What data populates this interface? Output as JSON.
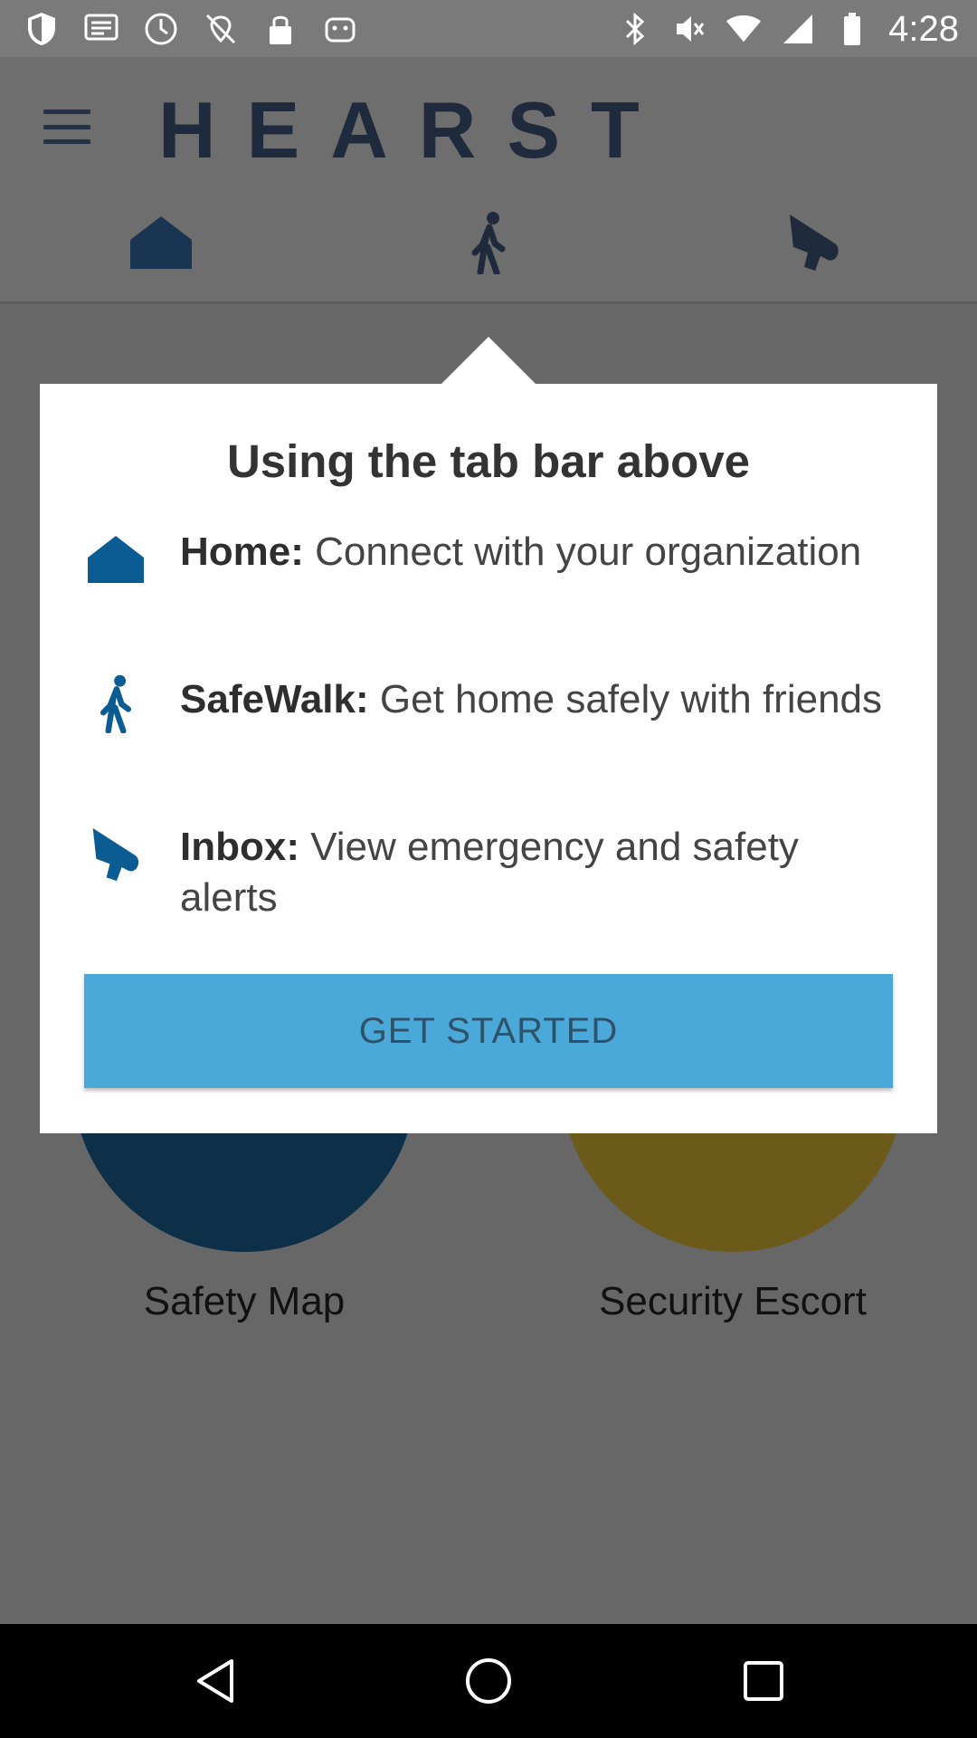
{
  "status_bar": {
    "time": "4:28",
    "left_icons": [
      "shield-icon",
      "message-icon",
      "do-not-disturb-icon",
      "no-location-icon",
      "lock-icon",
      "app-icon"
    ],
    "right_icons": [
      "bluetooth-icon",
      "mute-icon",
      "wifi-icon",
      "signal-icon",
      "battery-icon"
    ]
  },
  "header": {
    "logo_text": "HEARST",
    "tabs": [
      "home-icon",
      "walker-icon",
      "megaphone-icon"
    ]
  },
  "background": {
    "tiles": [
      {
        "label": "Safety Map",
        "color": "#0d2f47"
      },
      {
        "label": "Security Escort",
        "color": "#6b5a1a"
      }
    ]
  },
  "dialog": {
    "title": "Using the tab bar above",
    "items": [
      {
        "icon": "home-icon",
        "label": "Home:",
        "text": " Connect with your organization"
      },
      {
        "icon": "walker-icon",
        "label": "SafeWalk:",
        "text": " Get home safely with friends"
      },
      {
        "icon": "megaphone-icon",
        "label": "Inbox:",
        "text": " View emergency and safety alerts"
      }
    ],
    "button_label": "GET STARTED"
  },
  "colors": {
    "accent": "#4aa9d8",
    "icon_blue": "#0c5c94",
    "logo": "#1f2b3d"
  },
  "nav_bar": {
    "buttons": [
      "back-icon",
      "home-circle-icon",
      "recents-icon"
    ]
  }
}
